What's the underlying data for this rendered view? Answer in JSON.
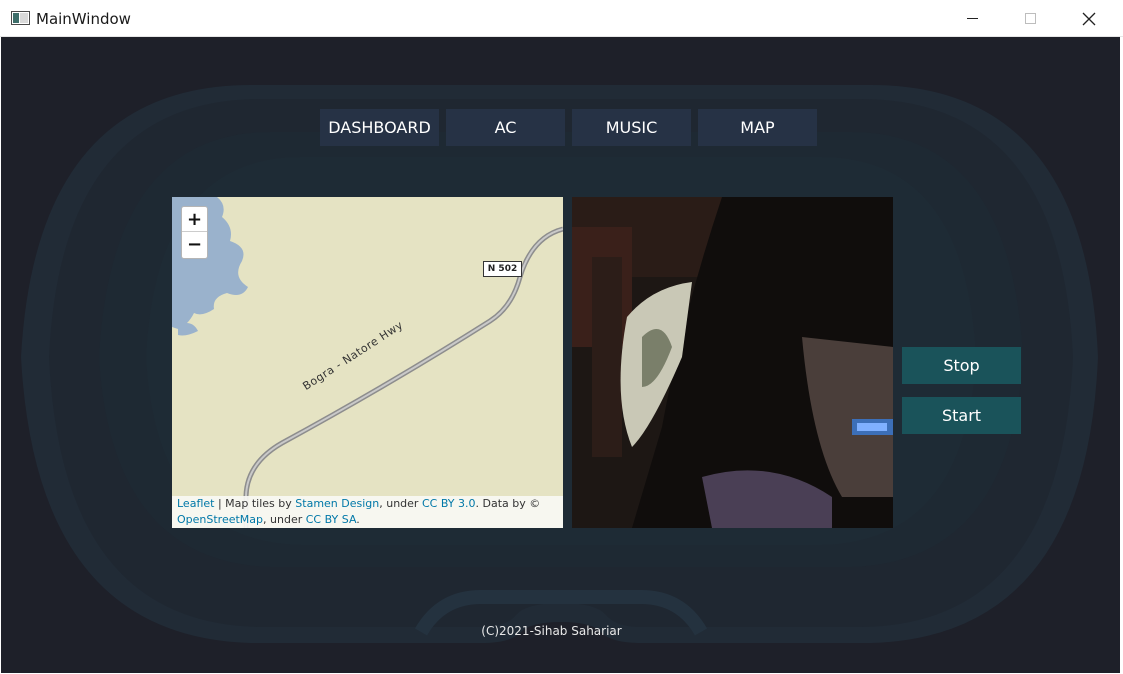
{
  "window": {
    "title": "MainWindow",
    "controls": {
      "minimize": "minimize-icon",
      "maximize": "maximize-icon",
      "close": "close-icon"
    }
  },
  "nav": {
    "tabs": [
      {
        "label": "DASHBOARD"
      },
      {
        "label": "AC"
      },
      {
        "label": "MUSIC"
      },
      {
        "label": "MAP"
      }
    ]
  },
  "map": {
    "zoom_in": "+",
    "zoom_out": "−",
    "road_shield": "N 502",
    "street_name": "Bogra - Natore Hwy",
    "attribution": {
      "leaflet": "Leaflet",
      "sep": " | Map tiles by ",
      "stamen": "Stamen Design",
      "under1": ", under ",
      "cc_by": "CC BY 3.0",
      "data_by": ". Data by © ",
      "osm": "OpenStreetMap",
      "under2": ", under ",
      "cc_by_sa": "CC BY SA",
      "end": "."
    }
  },
  "camera": {
    "feed": "webcam-feed"
  },
  "controls": {
    "stop_label": "Stop",
    "start_label": "Start"
  },
  "footer": {
    "copyright": "(C)2021-Sihab Sahariar"
  },
  "colors": {
    "background": "#1e2029",
    "frame": "#1f2b36",
    "nav_button": "#263245",
    "action_button": "#1a535a",
    "map_land": "#e6e4c4",
    "map_water": "#9ab2cc",
    "link": "#0078a8"
  }
}
